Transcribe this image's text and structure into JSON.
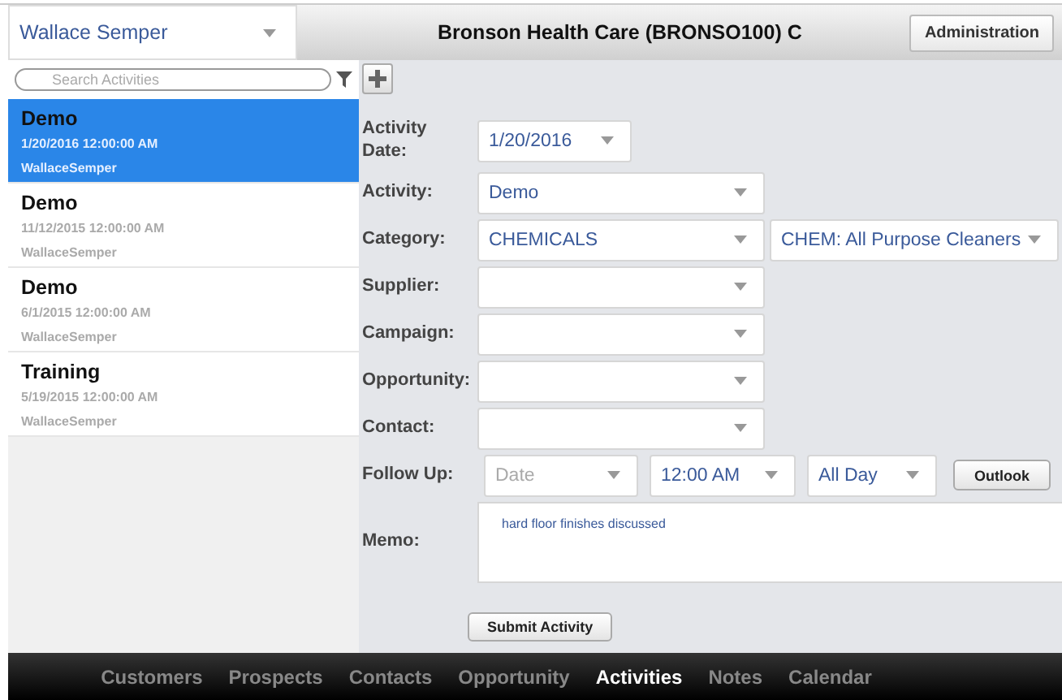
{
  "user_select": {
    "value": "Wallace Semper"
  },
  "header": {
    "title": "Bronson Health Care (BRONSO100) C",
    "admin_button": "Administration"
  },
  "search": {
    "placeholder": "Search Activities"
  },
  "activities": [
    {
      "title": "Demo",
      "date": "1/20/2016 12:00:00 AM",
      "owner": "WallaceSemper",
      "selected": true
    },
    {
      "title": "Demo",
      "date": "11/12/2015 12:00:00 AM",
      "owner": "WallaceSemper",
      "selected": false
    },
    {
      "title": "Demo",
      "date": "6/1/2015 12:00:00 AM",
      "owner": "WallaceSemper",
      "selected": false
    },
    {
      "title": "Training",
      "date": "5/19/2015 12:00:00 AM",
      "owner": "WallaceSemper",
      "selected": false
    }
  ],
  "form": {
    "rows": [
      {
        "kind": "date",
        "label": "Activity Date:",
        "fields": [
          {
            "value": "1/20/2016"
          }
        ]
      },
      {
        "kind": "select",
        "label": "Activity:",
        "fields": [
          {
            "value": "Demo"
          }
        ]
      },
      {
        "kind": "pair",
        "label": "Category:",
        "fields": [
          {
            "value": "CHEMICALS"
          },
          {
            "value": "CHEM: All Purpose Cleaners"
          }
        ]
      },
      {
        "kind": "select",
        "label": "Supplier:"
      },
      {
        "kind": "select",
        "label": "Campaign:"
      },
      {
        "kind": "select",
        "label": "Opportunity:"
      },
      {
        "kind": "select",
        "label": "Contact:"
      },
      {
        "kind": "followup",
        "label": "Follow Up:",
        "fields": [
          {
            "placeholder": "Date"
          },
          {
            "value": "12:00 AM"
          },
          {
            "value": "All Day"
          }
        ],
        "button": "Outlook"
      },
      {
        "kind": "memo",
        "label": "Memo:",
        "value": "hard floor finishes discussed"
      }
    ],
    "submit": "Submit Activity"
  },
  "nav": [
    {
      "label": "Customers",
      "selected": false
    },
    {
      "label": "Prospects",
      "selected": false
    },
    {
      "label": "Contacts",
      "selected": false
    },
    {
      "label": "Opportunity",
      "selected": false
    },
    {
      "label": "Activities",
      "selected": true
    },
    {
      "label": "Notes",
      "selected": false
    },
    {
      "label": "Calendar",
      "selected": false
    }
  ]
}
